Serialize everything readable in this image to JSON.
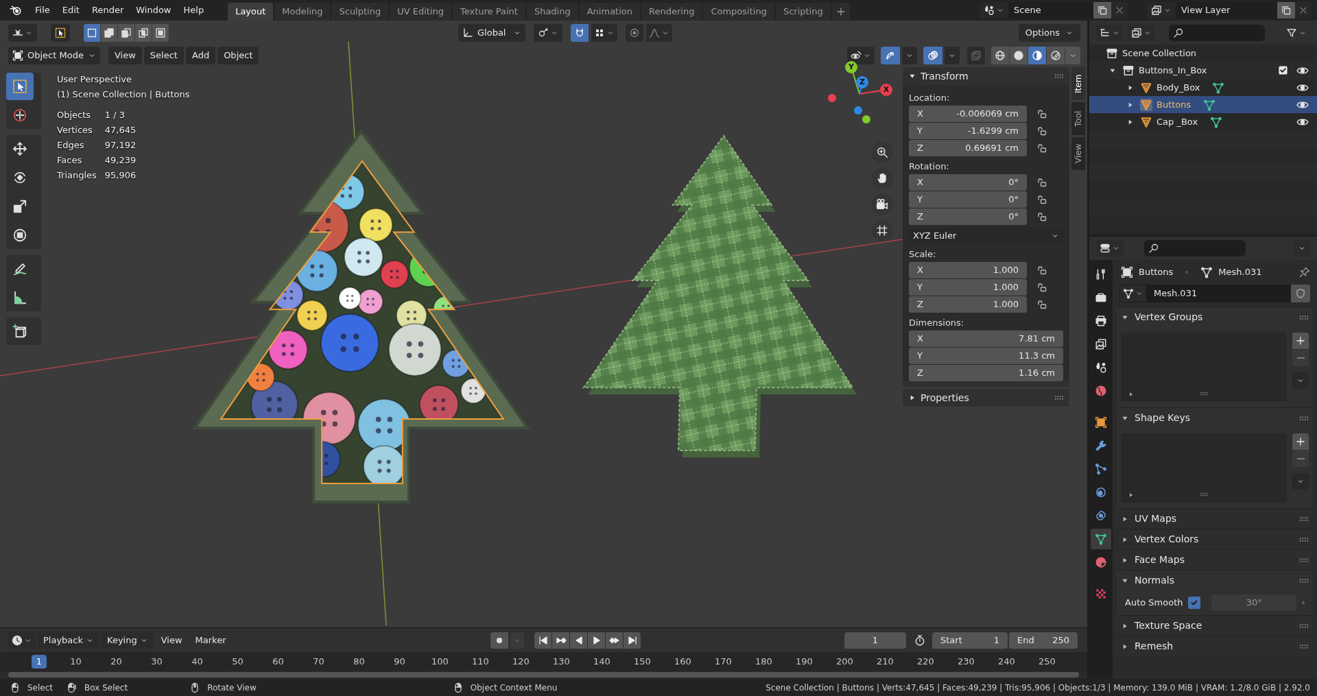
{
  "top_bar": {
    "menus": [
      "File",
      "Edit",
      "Render",
      "Window",
      "Help"
    ],
    "workspaces": [
      {
        "label": "Layout",
        "selected": true
      },
      {
        "label": "Modeling",
        "selected": false
      },
      {
        "label": "Sculpting",
        "selected": false
      },
      {
        "label": "UV Editing",
        "selected": false
      },
      {
        "label": "Texture Paint",
        "selected": false
      },
      {
        "label": "Shading",
        "selected": false
      },
      {
        "label": "Animation",
        "selected": false
      },
      {
        "label": "Rendering",
        "selected": false
      },
      {
        "label": "Compositing",
        "selected": false
      },
      {
        "label": "Scripting",
        "selected": false
      }
    ],
    "scene": "Scene",
    "view_layer": "View Layer"
  },
  "tool_header": {
    "select_modes": [
      {
        "selected": true
      },
      {
        "selected": false
      },
      {
        "selected": false
      },
      {
        "selected": false
      },
      {
        "selected": false
      }
    ],
    "orientation": "Global",
    "snap": {
      "on": true
    },
    "proportional_edit": {
      "on": false
    },
    "options": "Options"
  },
  "viewport_header": {
    "mode": "Object Mode",
    "menus": [
      "View",
      "Select",
      "Add",
      "Object"
    ],
    "gizmos": {
      "on": true
    },
    "overlays": {
      "on": true
    },
    "xray": {
      "on": false
    },
    "shading": [
      {
        "kind": "wireframe",
        "selected": false
      },
      {
        "kind": "solid",
        "selected": false
      },
      {
        "kind": "material",
        "selected": true
      },
      {
        "kind": "rendered",
        "selected": false
      }
    ]
  },
  "toolbar": [
    [
      {
        "kind": "select",
        "selected": true
      },
      {
        "kind": "cursor",
        "selected": false
      }
    ],
    [
      {
        "kind": "move",
        "selected": false
      },
      {
        "kind": "rotate",
        "selected": false
      },
      {
        "kind": "scale",
        "selected": false
      },
      {
        "kind": "transform",
        "selected": false
      }
    ],
    [
      {
        "kind": "annotate",
        "selected": false
      },
      {
        "kind": "measure",
        "selected": false
      }
    ],
    [
      {
        "kind": "add_cube",
        "selected": false
      }
    ]
  ],
  "viewport_info": {
    "view_name": "User Perspective",
    "collection_line": "(1) Scene Collection | Buttons",
    "stats": [
      {
        "label": "Objects",
        "value": "1 / 3"
      },
      {
        "label": "Vertices",
        "value": "47,645"
      },
      {
        "label": "Edges",
        "value": "97,192"
      },
      {
        "label": "Faces",
        "value": "49,239"
      },
      {
        "label": "Triangles",
        "value": "95,906"
      }
    ]
  },
  "gizmo": {
    "axes": [
      {
        "label": "X",
        "color": "#e8404f"
      },
      {
        "label": "Y",
        "color": "#82c92a"
      },
      {
        "label": "Z",
        "color": "#2e8ae6"
      }
    ]
  },
  "sidebar": {
    "tabs": [
      {
        "label": "Item",
        "selected": true
      },
      {
        "label": "Tool",
        "selected": false
      },
      {
        "label": "View",
        "selected": false
      }
    ],
    "transform": {
      "title": "Transform",
      "expanded": true,
      "groups": [
        {
          "kind": "vector",
          "label": "Location:",
          "fields": [
            {
              "axis": "X",
              "value": "-0.006069 cm"
            },
            {
              "axis": "Y",
              "value": "-1.6299 cm"
            },
            {
              "axis": "Z",
              "value": "0.69691 cm"
            }
          ]
        },
        {
          "kind": "vector",
          "label": "Rotation:",
          "fields": [
            {
              "axis": "X",
              "value": "0°"
            },
            {
              "axis": "Y",
              "value": "0°"
            },
            {
              "axis": "Z",
              "value": "0°"
            }
          ]
        },
        {
          "kind": "dropdown",
          "value": "XYZ Euler"
        },
        {
          "kind": "vector",
          "label": "Scale:",
          "fields": [
            {
              "axis": "X",
              "value": "1.000"
            },
            {
              "axis": "Y",
              "value": "1.000"
            },
            {
              "axis": "Z",
              "value": "1.000"
            }
          ]
        },
        {
          "kind": "dimensions",
          "label": "Dimensions:",
          "fields": [
            {
              "axis": "X",
              "value": "7.81 cm"
            },
            {
              "axis": "Y",
              "value": "11.3 cm"
            },
            {
              "axis": "Z",
              "value": "1.16 cm"
            }
          ]
        }
      ]
    },
    "properties": {
      "title": "Properties",
      "expanded": false
    }
  },
  "outliner": {
    "root": {
      "label": "Scene Collection"
    },
    "items": [
      {
        "kind": "collection",
        "label": "Buttons_In_Box",
        "expanded": true,
        "checked": true,
        "selected": false,
        "children": [
          {
            "kind": "mesh",
            "label": "Body_Box",
            "expanded": false,
            "selected": false
          },
          {
            "kind": "mesh",
            "label": "Buttons",
            "expanded": false,
            "selected": true
          },
          {
            "kind": "mesh",
            "label": "Cap _Box",
            "expanded": false,
            "selected": false
          }
        ]
      }
    ]
  },
  "properties_editor": {
    "tabs": [
      {
        "kind": "tool",
        "selected": false
      },
      {
        "kind": "render",
        "selected": false
      },
      {
        "kind": "output",
        "selected": false
      },
      {
        "kind": "view_layer",
        "selected": false
      },
      {
        "kind": "scene",
        "selected": false
      },
      {
        "kind": "world",
        "selected": false
      },
      {
        "kind": "object",
        "selected": false
      },
      {
        "kind": "modifiers",
        "selected": false
      },
      {
        "kind": "particles",
        "selected": false
      },
      {
        "kind": "physics",
        "selected": false
      },
      {
        "kind": "constraints",
        "selected": false
      },
      {
        "kind": "data",
        "selected": true
      },
      {
        "kind": "material",
        "selected": false
      },
      {
        "kind": "texture",
        "selected": false
      }
    ],
    "breadcrumb": [
      "Buttons",
      "Mesh.031"
    ],
    "mesh_name": "Mesh.031",
    "panels": [
      {
        "kind": "list",
        "title": "Vertex Groups",
        "expanded": true
      },
      {
        "kind": "list",
        "title": "Shape Keys",
        "expanded": true
      },
      {
        "title": "UV Maps",
        "expanded": false
      },
      {
        "title": "Vertex Colors",
        "expanded": false
      },
      {
        "title": "Face Maps",
        "expanded": false
      },
      {
        "kind": "normals",
        "title": "Normals",
        "expanded": true,
        "auto_smooth": {
          "label": "Auto Smooth",
          "checked": true,
          "angle": "30°"
        }
      },
      {
        "title": "Texture Space",
        "expanded": false
      },
      {
        "title": "Remesh",
        "expanded": false
      }
    ]
  },
  "timeline": {
    "menus": [
      {
        "label": "Playback",
        "dropdown": true
      },
      {
        "label": "Keying",
        "dropdown": true
      },
      {
        "label": "View",
        "dropdown": false
      },
      {
        "label": "Marker",
        "dropdown": false
      }
    ],
    "current_frame": "1",
    "start_label": "Start",
    "start": "1",
    "end_label": "End",
    "end": "250",
    "ruler": {
      "current": "1",
      "ticks": [
        "10",
        "20",
        "30",
        "40",
        "50",
        "60",
        "70",
        "80",
        "90",
        "100",
        "110",
        "120",
        "130",
        "140",
        "150",
        "160",
        "170",
        "180",
        "190",
        "200",
        "210",
        "220",
        "230",
        "240",
        "250"
      ]
    }
  },
  "status_bar": {
    "hints": [
      {
        "kind": "mouse_left",
        "label": "Select"
      },
      {
        "kind": "mouse_drag",
        "label": "Box Select"
      },
      {
        "kind": "mouse_middle",
        "label": "Rotate View"
      },
      {
        "kind": "mouse_right",
        "label": "Object Context Menu"
      }
    ],
    "stats": "Scene Collection | Buttons | Verts:47,645 | Faces:49,239 | Tris:95,906 | Objects:1/3 | Memory: 139.0 MiB | VRAM: 1.2/8.0 GiB | 2.92.0"
  }
}
